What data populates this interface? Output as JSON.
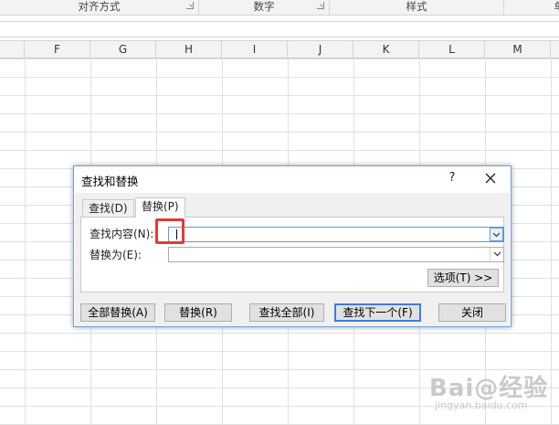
{
  "ribbon": {
    "groups": [
      {
        "label": "对齐方式",
        "launcher": true
      },
      {
        "label": "数字",
        "launcher": true
      },
      {
        "label": "样式",
        "launcher": false
      },
      {
        "label": "单",
        "launcher": false
      }
    ]
  },
  "columns": [
    "F",
    "G",
    "H",
    "I",
    "J",
    "K",
    "L",
    "M"
  ],
  "dialog": {
    "title": "查找和替换",
    "help": "?",
    "close_icon": "close-icon",
    "tabs": [
      {
        "label": "查找(D)",
        "active": false
      },
      {
        "label": "替换(P)",
        "active": true
      }
    ],
    "find_label": "查找内容(N):",
    "find_value": "",
    "replace_label": "替换为(E):",
    "replace_value": "",
    "options_button": "选项(T) >>",
    "buttons": {
      "replace_all": "全部替换(A)",
      "replace": "替换(R)",
      "find_all": "查找全部(I)",
      "find_next": "查找下一个(F)",
      "close": "关闭"
    }
  },
  "watermark": {
    "main": "Bai@经验",
    "sub": "jingyan.baidu.com"
  },
  "colors": {
    "highlight": "#e53935",
    "dialog_border": "#6f9fd8",
    "default_button": "#3c7fd4"
  }
}
